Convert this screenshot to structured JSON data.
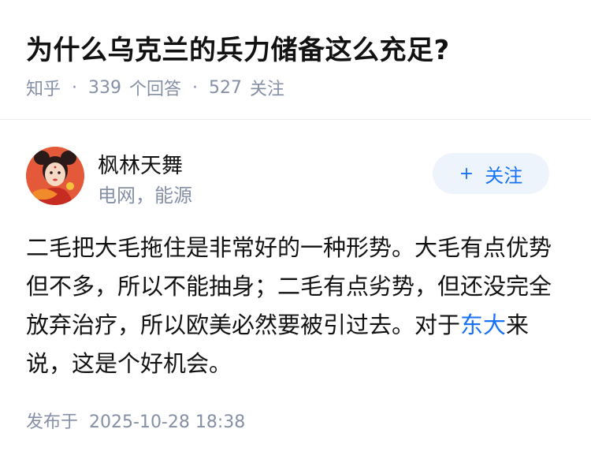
{
  "question": {
    "title": "为什么乌克兰的兵力储备这么充足?",
    "source": "知乎",
    "answer_count": "339",
    "answer_label": "个回答",
    "follower_count": "527",
    "follower_label": "关注"
  },
  "author": {
    "name": "枫林天舞",
    "tagline": "电网，能源",
    "follow_label": "关注",
    "follow_icon": "plus-icon"
  },
  "answer": {
    "text_before_link": "二毛把大毛拖住是非常好的一种形势。大毛有点优势但不多，所以不能抽身；二毛有点劣势，但还没完全放弃治疗，所以欧美必然要被引过去。对于",
    "link_text": "东大",
    "text_after_link": "来说，这是个好机会。"
  },
  "footer": {
    "published_label": "发布于",
    "published_date": "2025-10-28 18:38"
  },
  "colors": {
    "accent": "#1772f6",
    "muted": "#8590a6",
    "follow_bg": "#eef4fb"
  }
}
